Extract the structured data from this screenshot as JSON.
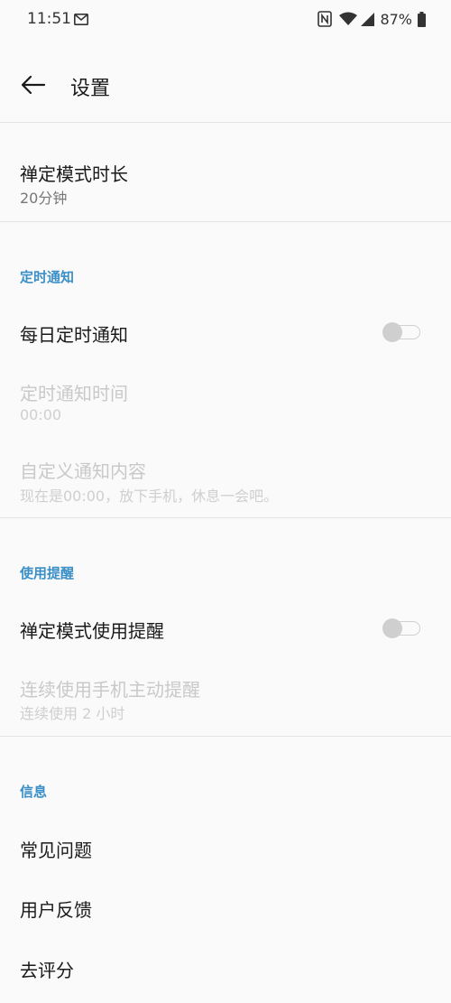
{
  "status_bar": {
    "time": "11:51",
    "battery_percent": "87%",
    "icons": [
      "mail-icon",
      "nfc-icon",
      "wifi-icon",
      "cell-signal-icon",
      "battery-icon"
    ]
  },
  "app_bar": {
    "title": "设置",
    "back_icon": "arrow-left-icon"
  },
  "main": {
    "zen_duration": {
      "title": "禅定模式时长",
      "value": "20分钟"
    },
    "sections": {
      "timed_notification": {
        "header": "定时通知",
        "daily_notification": {
          "title": "每日定时通知",
          "toggle_on": false
        },
        "notification_time": {
          "title": "定时通知时间",
          "value": "00:00"
        },
        "custom_content": {
          "title": "自定义通知内容",
          "value": "现在是00:00，放下手机，休息一会吧。"
        }
      },
      "usage_reminder": {
        "header": "使用提醒",
        "zen_usage_reminder": {
          "title": "禅定模式使用提醒",
          "toggle_on": false
        },
        "continuous_use": {
          "title": "连续使用手机主动提醒",
          "value": "连续使用 2 小时"
        }
      },
      "info": {
        "header": "信息",
        "faq": "常见问题",
        "feedback": "用户反馈",
        "rate": "去评分"
      }
    }
  },
  "colors": {
    "background": "#fafafa",
    "accent": "#3a8fc7",
    "disabled_text": "#c9c9c9",
    "toggle_off": "#cfcfcf"
  }
}
